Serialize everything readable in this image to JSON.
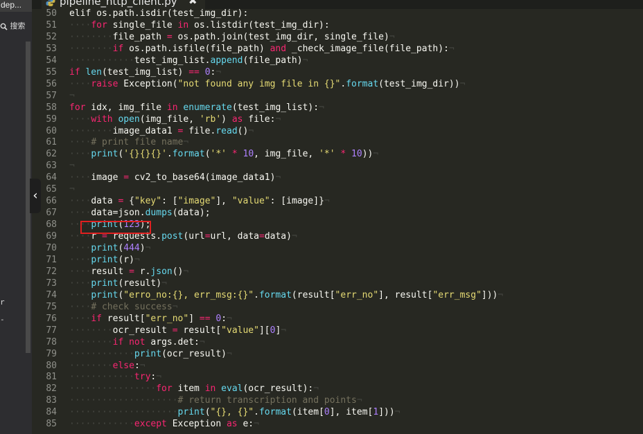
{
  "side_panel": {
    "tab_label": "dep...",
    "search_label": "搜索",
    "fragment_1": "r",
    "fragment_2": "-"
  },
  "tab": {
    "title": "pipeline_http_client.py",
    "close_glyph": "✖"
  },
  "collapse_glyph": "‹",
  "colors": {
    "background": "#272822",
    "keyword": "#f92672",
    "function": "#66d9ef",
    "string": "#e6db74",
    "number": "#ae81ff",
    "comment": "#75715e",
    "highlight_box": "#e02020"
  },
  "code_lines": [
    {
      "ln": "50",
      "segs": [
        [
          "",
          "elif os.path.isdir(test_img_dir):"
        ]
      ]
    },
    {
      "ln": "51",
      "segs": [
        [
          "ws",
          "····"
        ],
        [
          "k",
          "for"
        ],
        [
          "p",
          " single_file "
        ],
        [
          "k",
          "in"
        ],
        [
          "p",
          " os."
        ],
        [
          "p",
          "listdir(test_img_dir):"
        ]
      ]
    },
    {
      "ln": "52",
      "segs": [
        [
          "ws",
          "········"
        ],
        [
          "p",
          "file_path "
        ],
        [
          "k",
          "="
        ],
        [
          "p",
          " os.path.join(test_img_dir, single_file)"
        ],
        [
          "ws",
          "¬"
        ]
      ]
    },
    {
      "ln": "53",
      "segs": [
        [
          "ws",
          "········"
        ],
        [
          "k",
          "if"
        ],
        [
          "p",
          " os.path.isfile(file_path) "
        ],
        [
          "k",
          "and"
        ],
        [
          "p",
          " _check_image_file(file_path):"
        ],
        [
          "ws",
          "¬"
        ]
      ]
    },
    {
      "ln": "54",
      "segs": [
        [
          "ws",
          "············"
        ],
        [
          "p",
          "test_img_list."
        ],
        [
          "f",
          "append"
        ],
        [
          "p",
          "(file_path)"
        ],
        [
          "ws",
          "¬"
        ]
      ]
    },
    {
      "ln": "55",
      "segs": [
        [
          "k",
          "if"
        ],
        [
          "p",
          " "
        ],
        [
          "f",
          "len"
        ],
        [
          "p",
          "(test_img_list) "
        ],
        [
          "k",
          "=="
        ],
        [
          "p",
          " "
        ],
        [
          "n",
          "0"
        ],
        [
          "p",
          ":"
        ],
        [
          "ws",
          "¬"
        ]
      ]
    },
    {
      "ln": "56",
      "segs": [
        [
          "ws",
          "····"
        ],
        [
          "k",
          "raise"
        ],
        [
          "p",
          " Exception("
        ],
        [
          "s",
          "\"not found any img file in {}\""
        ],
        [
          "p",
          "."
        ],
        [
          "f",
          "format"
        ],
        [
          "p",
          "(test_img_dir))"
        ],
        [
          "ws",
          "¬"
        ]
      ]
    },
    {
      "ln": "57",
      "segs": [
        [
          "ws",
          "¬"
        ]
      ]
    },
    {
      "ln": "58",
      "segs": [
        [
          "k",
          "for"
        ],
        [
          "p",
          " idx, img_file "
        ],
        [
          "k",
          "in"
        ],
        [
          "p",
          " "
        ],
        [
          "f",
          "enumerate"
        ],
        [
          "p",
          "(test_img_list):"
        ],
        [
          "ws",
          "¬"
        ]
      ]
    },
    {
      "ln": "59",
      "segs": [
        [
          "ws",
          "····"
        ],
        [
          "k",
          "with"
        ],
        [
          "p",
          " "
        ],
        [
          "f",
          "open"
        ],
        [
          "p",
          "(img_file, "
        ],
        [
          "s",
          "'rb'"
        ],
        [
          "p",
          ") "
        ],
        [
          "k",
          "as"
        ],
        [
          "p",
          " file:"
        ],
        [
          "ws",
          "¬"
        ]
      ]
    },
    {
      "ln": "60",
      "segs": [
        [
          "ws",
          "········"
        ],
        [
          "p",
          "image_data1 "
        ],
        [
          "k",
          "="
        ],
        [
          "p",
          " file."
        ],
        [
          "f",
          "read"
        ],
        [
          "p",
          "()"
        ],
        [
          "ws",
          "¬"
        ]
      ]
    },
    {
      "ln": "61",
      "segs": [
        [
          "ws",
          "····"
        ],
        [
          "c",
          "# print file name"
        ],
        [
          "ws",
          "¬"
        ]
      ]
    },
    {
      "ln": "62",
      "segs": [
        [
          "ws",
          "····"
        ],
        [
          "f",
          "print"
        ],
        [
          "p",
          "("
        ],
        [
          "s",
          "'{}{}{}'"
        ],
        [
          "p",
          "."
        ],
        [
          "f",
          "format"
        ],
        [
          "p",
          "("
        ],
        [
          "s",
          "'*'"
        ],
        [
          "p",
          " "
        ],
        [
          "k",
          "*"
        ],
        [
          "p",
          " "
        ],
        [
          "n",
          "10"
        ],
        [
          "p",
          ", img_file, "
        ],
        [
          "s",
          "'*'"
        ],
        [
          "p",
          " "
        ],
        [
          "k",
          "*"
        ],
        [
          "p",
          " "
        ],
        [
          "n",
          "10"
        ],
        [
          "p",
          "))"
        ],
        [
          "ws",
          "¬"
        ]
      ]
    },
    {
      "ln": "63",
      "segs": [
        [
          "ws",
          "¬"
        ]
      ]
    },
    {
      "ln": "64",
      "segs": [
        [
          "ws",
          "····"
        ],
        [
          "p",
          "image "
        ],
        [
          "k",
          "="
        ],
        [
          "p",
          " cv2_to_base64(image_data1)"
        ],
        [
          "ws",
          "¬"
        ]
      ]
    },
    {
      "ln": "65",
      "segs": [
        [
          "ws",
          "¬"
        ]
      ]
    },
    {
      "ln": "66",
      "segs": [
        [
          "ws",
          "····"
        ],
        [
          "p",
          "data "
        ],
        [
          "k",
          "="
        ],
        [
          "p",
          " {"
        ],
        [
          "s",
          "\"key\""
        ],
        [
          "p",
          ": ["
        ],
        [
          "s",
          "\"image\""
        ],
        [
          "p",
          "], "
        ],
        [
          "s",
          "\"value\""
        ],
        [
          "p",
          ": [image]}"
        ],
        [
          "ws",
          "¬"
        ]
      ]
    },
    {
      "ln": "67",
      "segs": [
        [
          "ws",
          "····"
        ],
        [
          "p",
          "data=json."
        ],
        [
          "f",
          "dumps"
        ],
        [
          "p",
          "(data);"
        ]
      ]
    },
    {
      "ln": "68",
      "segs": [
        [
          "ws",
          "····"
        ],
        [
          "f",
          "print"
        ],
        [
          "p",
          "("
        ],
        [
          "n",
          "123"
        ],
        [
          "p",
          ");"
        ]
      ]
    },
    {
      "ln": "69",
      "segs": [
        [
          "ws",
          "····"
        ],
        [
          "p",
          "r "
        ],
        [
          "k",
          "="
        ],
        [
          "p",
          " requests."
        ],
        [
          "f",
          "post"
        ],
        [
          "p",
          "(url"
        ],
        [
          "k",
          "="
        ],
        [
          "p",
          "url, data"
        ],
        [
          "k",
          "="
        ],
        [
          "p",
          "data)"
        ],
        [
          "ws",
          "¬"
        ]
      ]
    },
    {
      "ln": "70",
      "segs": [
        [
          "ws",
          "····"
        ],
        [
          "f",
          "print"
        ],
        [
          "p",
          "("
        ],
        [
          "n",
          "444"
        ],
        [
          "p",
          ")"
        ],
        [
          "ws",
          "¬"
        ]
      ]
    },
    {
      "ln": "71",
      "segs": [
        [
          "ws",
          "····"
        ],
        [
          "f",
          "print"
        ],
        [
          "p",
          "(r)"
        ],
        [
          "ws",
          "¬"
        ]
      ]
    },
    {
      "ln": "72",
      "segs": [
        [
          "ws",
          "····"
        ],
        [
          "p",
          "result "
        ],
        [
          "k",
          "="
        ],
        [
          "p",
          " r."
        ],
        [
          "f",
          "json"
        ],
        [
          "p",
          "()"
        ],
        [
          "ws",
          "¬"
        ]
      ]
    },
    {
      "ln": "73",
      "segs": [
        [
          "ws",
          "····"
        ],
        [
          "f",
          "print"
        ],
        [
          "p",
          "(result)"
        ],
        [
          "ws",
          "¬"
        ]
      ]
    },
    {
      "ln": "74",
      "segs": [
        [
          "ws",
          "····"
        ],
        [
          "f",
          "print"
        ],
        [
          "p",
          "("
        ],
        [
          "s",
          "\"erro_no:{}, err_msg:{}\""
        ],
        [
          "p",
          "."
        ],
        [
          "f",
          "format"
        ],
        [
          "p",
          "(result["
        ],
        [
          "s",
          "\"err_no\""
        ],
        [
          "p",
          "], result["
        ],
        [
          "s",
          "\"err_msg\""
        ],
        [
          "p",
          "]))"
        ],
        [
          "ws",
          "¬"
        ]
      ]
    },
    {
      "ln": "75",
      "segs": [
        [
          "ws",
          "····"
        ],
        [
          "c",
          "# check success"
        ],
        [
          "ws",
          "¬"
        ]
      ]
    },
    {
      "ln": "76",
      "segs": [
        [
          "ws",
          "····"
        ],
        [
          "k",
          "if"
        ],
        [
          "p",
          " result["
        ],
        [
          "s",
          "\"err_no\""
        ],
        [
          "p",
          "] "
        ],
        [
          "k",
          "=="
        ],
        [
          "p",
          " "
        ],
        [
          "n",
          "0"
        ],
        [
          "p",
          ":"
        ],
        [
          "ws",
          "¬"
        ]
      ]
    },
    {
      "ln": "77",
      "segs": [
        [
          "ws",
          "········"
        ],
        [
          "p",
          "ocr_result "
        ],
        [
          "k",
          "="
        ],
        [
          "p",
          " result["
        ],
        [
          "s",
          "\"value\""
        ],
        [
          "p",
          "]["
        ],
        [
          "n",
          "0"
        ],
        [
          "p",
          "]"
        ],
        [
          "ws",
          "¬"
        ]
      ]
    },
    {
      "ln": "78",
      "segs": [
        [
          "ws",
          "········"
        ],
        [
          "k",
          "if"
        ],
        [
          "p",
          " "
        ],
        [
          "k",
          "not"
        ],
        [
          "p",
          " args.det:"
        ],
        [
          "ws",
          "¬"
        ]
      ]
    },
    {
      "ln": "79",
      "segs": [
        [
          "ws",
          "············"
        ],
        [
          "f",
          "print"
        ],
        [
          "p",
          "(ocr_result)"
        ],
        [
          "ws",
          "¬"
        ]
      ]
    },
    {
      "ln": "80",
      "segs": [
        [
          "ws",
          "········"
        ],
        [
          "k",
          "else"
        ],
        [
          "p",
          ":"
        ],
        [
          "ws",
          "¬"
        ]
      ]
    },
    {
      "ln": "81",
      "segs": [
        [
          "ws",
          "············"
        ],
        [
          "k",
          "try"
        ],
        [
          "p",
          ":"
        ],
        [
          "ws",
          "¬"
        ]
      ]
    },
    {
      "ln": "82",
      "segs": [
        [
          "ws",
          "················"
        ],
        [
          "k",
          "for"
        ],
        [
          "p",
          " item "
        ],
        [
          "k",
          "in"
        ],
        [
          "p",
          " "
        ],
        [
          "f",
          "eval"
        ],
        [
          "p",
          "(ocr_result):"
        ],
        [
          "ws",
          "¬"
        ]
      ]
    },
    {
      "ln": "83",
      "segs": [
        [
          "ws",
          "····················"
        ],
        [
          "c",
          "# return transcription and points"
        ],
        [
          "ws",
          "¬"
        ]
      ]
    },
    {
      "ln": "84",
      "segs": [
        [
          "ws",
          "····················"
        ],
        [
          "f",
          "print"
        ],
        [
          "p",
          "("
        ],
        [
          "s",
          "\"{}, {}\""
        ],
        [
          "p",
          "."
        ],
        [
          "f",
          "format"
        ],
        [
          "p",
          "(item["
        ],
        [
          "n",
          "0"
        ],
        [
          "p",
          "], item["
        ],
        [
          "n",
          "1"
        ],
        [
          "p",
          "]))"
        ],
        [
          "ws",
          "¬"
        ]
      ]
    },
    {
      "ln": "85",
      "segs": [
        [
          "ws",
          "············"
        ],
        [
          "k",
          "except"
        ],
        [
          "p",
          " Exception "
        ],
        [
          "k",
          "as"
        ],
        [
          "p",
          " e:"
        ],
        [
          "ws",
          "¬"
        ]
      ]
    }
  ]
}
